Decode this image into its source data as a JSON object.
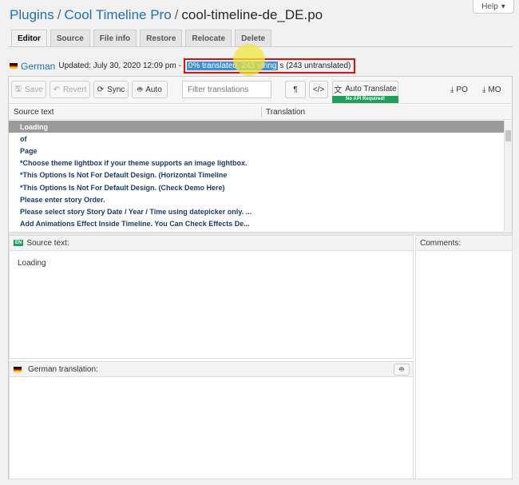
{
  "help": {
    "label": "Help"
  },
  "breadcrumb": {
    "plugins": "Plugins",
    "plugin": "Cool Timeline Pro",
    "file": "cool-timeline-de_DE.po"
  },
  "tabs": [
    "Editor",
    "Source",
    "File info",
    "Restore",
    "Relocate",
    "Delete"
  ],
  "status": {
    "language": "German",
    "updated": "Updated: July 30, 2020 12:09 pm -",
    "translated_part": "0% translated, 243 string",
    "rest_part": "s (243 untranslated)"
  },
  "toolbar": {
    "save": "Save",
    "revert": "Revert",
    "sync": "Sync",
    "auto": "Auto",
    "filter_placeholder": "Filter translations",
    "auto_translate": "Auto Translate",
    "api_badge": "No API Required!",
    "po": "PO",
    "mo": "MO"
  },
  "list": {
    "source_header": "Source text",
    "translation_header": "Translation",
    "rows": [
      "Loading",
      "of",
      "Page",
      "*Choose theme lightbox if your theme supports an image lightbox.",
      "*This Options Is Not For Default Design. (Horizontal Timeline",
      "*This Options Is Not For Default Design. (Check Demo Here)",
      "Please enter story Order.",
      "Please select story Story Date / Year / Time using datepicker only. ...",
      "Add Animations Effect Inside Timeline. You Can Check Effects De..."
    ]
  },
  "source_panel": {
    "badge": "EN",
    "title": "Source text:",
    "text": "Loading"
  },
  "comments_panel": {
    "title": "Comments:"
  },
  "translation_panel": {
    "title": "German translation:"
  },
  "colors": {
    "accent": "#2271b1",
    "highlight_box": "#e10e0e",
    "selected_row": "#9a9a9a",
    "api_badge": "#1da359"
  }
}
